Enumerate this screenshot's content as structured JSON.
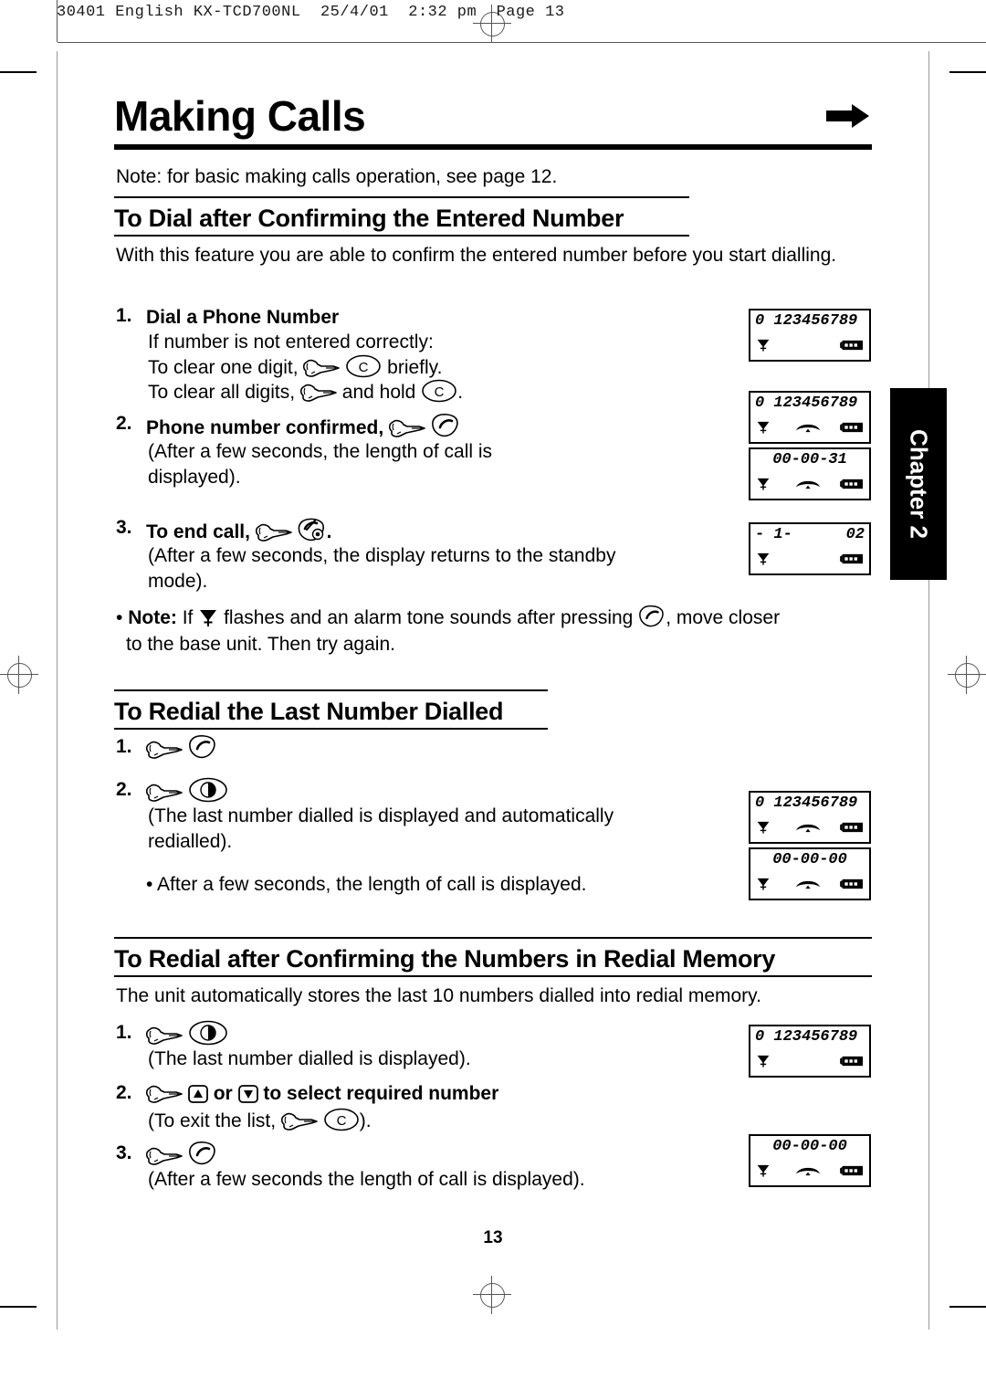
{
  "prepress": {
    "header": "30401 English KX-TCD700NL  25/4/01  2:32 pm  Page 13"
  },
  "page": {
    "title": "Making Calls",
    "arrow_icon": "right-arrow-icon",
    "note_top": "Note: for basic making calls operation, see page 12.",
    "page_number": "13",
    "chapter_tab": "Chapter 2"
  },
  "section1": {
    "heading": "To Dial after Confirming the Entered Number",
    "intro": "With this feature you are able to confirm the entered number before you start dialling.",
    "step1": {
      "num": "1.",
      "title": "Dial a Phone Number",
      "line1": "If number is not entered correctly:",
      "line2_pre": "To clear one digit,",
      "line2_post": "briefly.",
      "line3_pre": "To clear all digits,",
      "line3_mid": "and hold",
      "line3_post": "."
    },
    "step2": {
      "num": "2.",
      "title": "Phone number confirmed,",
      "detail1": "(After a few seconds, the length of call is",
      "detail2": "displayed)."
    },
    "step3": {
      "num": "3.",
      "title": "To end call,",
      "title_post": ".",
      "detail1": "(After a few seconds, the display returns to the standby",
      "detail2": " mode)."
    },
    "note": {
      "bullet": "•",
      "label": "Note:",
      "pre": "If",
      "mid": "flashes and an alarm tone sounds after pressing",
      "post": ", move closer",
      "line2": "to the base unit. Then try again."
    }
  },
  "section2": {
    "heading": "To Redial the Last Number Dialled",
    "step1": {
      "num": "1."
    },
    "step2": {
      "num": "2.",
      "detail1": "(The last number dialled is displayed and automatically",
      "detail2": "redialled)."
    },
    "bullet_note": "• After a few seconds, the length of call is displayed."
  },
  "section3": {
    "heading": "To Redial after Confirming the Numbers in Redial Memory",
    "intro": "The unit automatically stores the last 10 numbers dialled into redial memory.",
    "step1": {
      "num": "1.",
      "detail": "(The last number dialled is displayed)."
    },
    "step2": {
      "num": "2.",
      "mid": "or",
      "post": "to select required number",
      "detail_pre": "(To exit the list,",
      "detail_post": ")."
    },
    "step3": {
      "num": "3.",
      "detail": "(After a few seconds the length of call is displayed)."
    }
  },
  "icons": {
    "hand": "pointing-hand-icon",
    "clear_key": "C",
    "talk_key": "talk-key-icon",
    "end_key": "end-call-key-icon",
    "redial_key": "redial-key-icon",
    "up_key": "▲",
    "down_key": "▼",
    "antenna": "antenna-icon",
    "battery": "battery-icon",
    "offhook": "off-hook-handset-icon"
  },
  "lcds": [
    {
      "id": "lcd-1",
      "line": "0 123456789",
      "align": "left",
      "antenna": true,
      "hook": false,
      "battery": true
    },
    {
      "id": "lcd-2",
      "line": "0 123456789",
      "align": "left",
      "antenna": true,
      "hook": true,
      "battery": true
    },
    {
      "id": "lcd-3",
      "line": "00-00-31",
      "align": "center",
      "antenna": true,
      "hook": true,
      "battery": true
    },
    {
      "id": "lcd-4",
      "line_left": "- 1-",
      "line_right": "02",
      "align": "split",
      "antenna": true,
      "hook": false,
      "battery": true
    },
    {
      "id": "lcd-5",
      "line": "0 123456789",
      "align": "left",
      "antenna": true,
      "hook": true,
      "battery": true
    },
    {
      "id": "lcd-6",
      "line": "00-00-00",
      "align": "center",
      "antenna": true,
      "hook": true,
      "battery": true
    },
    {
      "id": "lcd-7",
      "line": "0 123456789",
      "align": "left",
      "antenna": true,
      "hook": false,
      "battery": true
    },
    {
      "id": "lcd-8",
      "line": "00-00-00",
      "align": "center",
      "antenna": true,
      "hook": true,
      "battery": true
    }
  ]
}
